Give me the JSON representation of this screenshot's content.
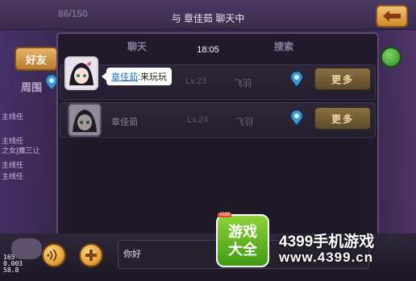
{
  "top": {
    "faded_counter": "86/150",
    "chat_title": "与 章佳茹 聊天中"
  },
  "panel": {
    "tabs": [
      "聊天",
      "搜索"
    ],
    "timestamp": "18:05"
  },
  "sidebar": {
    "friend_tab": "好友",
    "second_tab": "周围",
    "chat_lines": [
      "主线任",
      "主线任",
      "之女]魔三让",
      "主线任",
      "主线任"
    ]
  },
  "message": {
    "sender": "章佳茹",
    "text": ":来玩玩"
  },
  "rows": [
    {
      "name": "章佳茹",
      "level": "Lv.23",
      "guild": "飞羽",
      "more_label": "更多"
    },
    {
      "name": "章佳茹",
      "level": "Lv.24",
      "guild": "飞羽",
      "more_label": "更多"
    }
  ],
  "bottom": {
    "input_value": "你好",
    "fps_lines": [
      "165",
      "0.003",
      "58.8"
    ]
  },
  "watermark": {
    "logo_line1": "游戏",
    "logo_line2": "大全",
    "logo_tag": "4399",
    "brand": "4399手机游戏",
    "url": "www.4399.cn"
  },
  "colors": {
    "accent_orange": "#d08a2c",
    "bubble_name": "#1e6fc8",
    "logo_green": "#3f9a12"
  }
}
